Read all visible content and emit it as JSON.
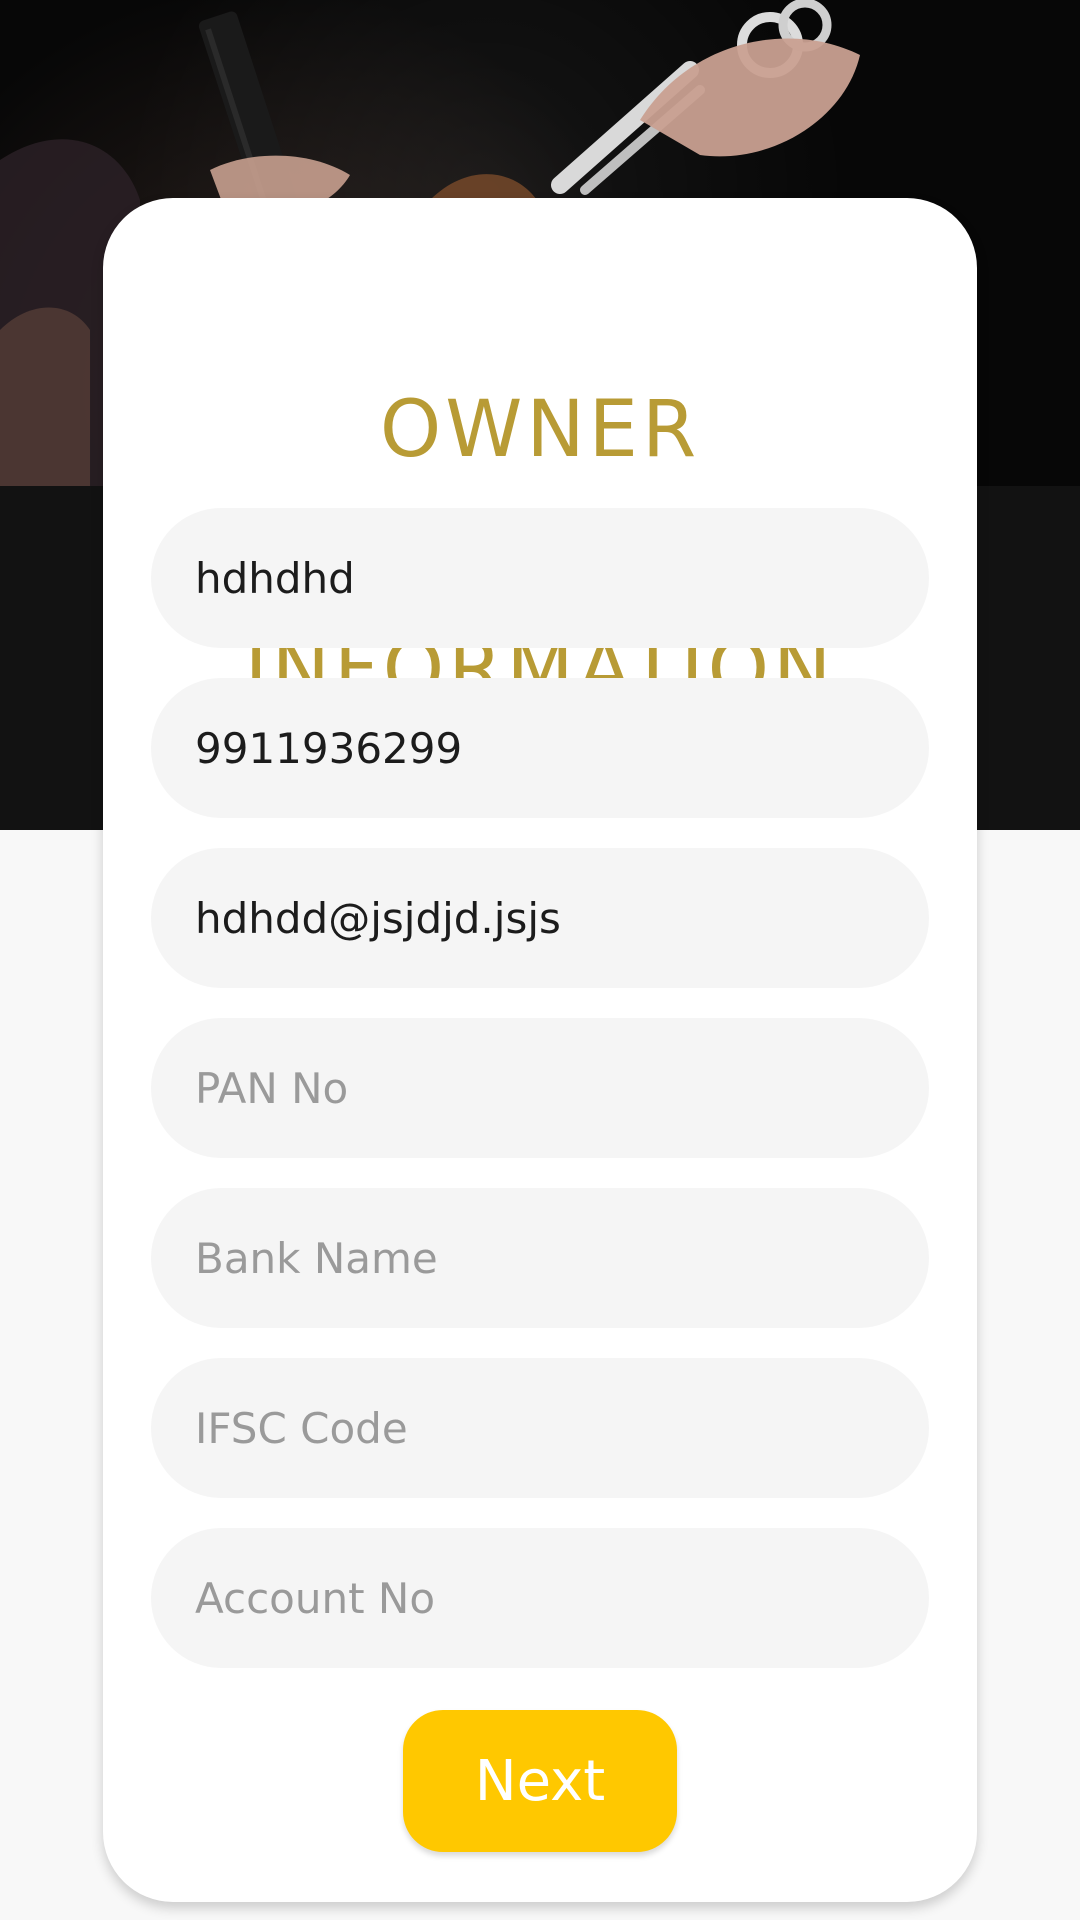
{
  "header": {
    "title_line1": "OWNER",
    "title_line2": "INFORMATION"
  },
  "form": {
    "fields": [
      {
        "name": "owner-name",
        "value": "hdhdhd",
        "placeholder": ""
      },
      {
        "name": "phone",
        "value": "9911936299",
        "placeholder": ""
      },
      {
        "name": "email",
        "value": "hdhdd@jsjdjd.jsjs",
        "placeholder": ""
      },
      {
        "name": "pan",
        "value": "",
        "placeholder": "PAN No"
      },
      {
        "name": "bank-name",
        "value": "",
        "placeholder": "Bank Name"
      },
      {
        "name": "ifsc",
        "value": "",
        "placeholder": "IFSC Code"
      },
      {
        "name": "account",
        "value": "",
        "placeholder": "Account No"
      }
    ],
    "next_label": "Next"
  },
  "colors": {
    "accent": "#ffc800",
    "title": "#b89b35",
    "field_bg": "#f5f5f5",
    "placeholder": "#9a9a9a"
  }
}
